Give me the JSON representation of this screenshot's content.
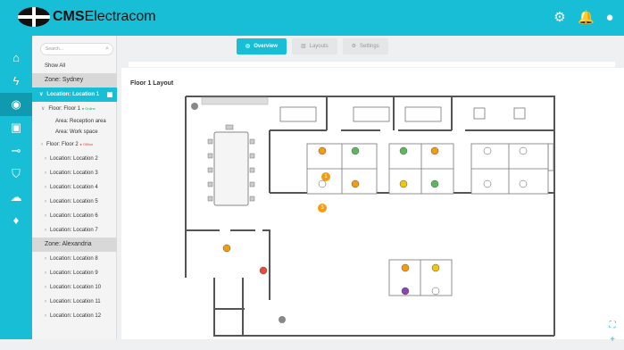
{
  "app": {
    "brand_bold": "CMS",
    "brand_light": "Electracom",
    "icons": [
      "settings-gear-icon",
      "alarm-bell-icon",
      "user-account-icon"
    ]
  },
  "rail": [
    "home-icon",
    "bolt-icon",
    "people-icon",
    "panel-icon",
    "key-icon",
    "shield-icon",
    "cloud-icon",
    "water-icon"
  ],
  "left_panel": {
    "search_placeholder": "Search...",
    "show_all": "Show All",
    "zone_sydney": "Zone: Sydney",
    "location_1": "Location: Location 1",
    "floor_1": "Floor: Floor 1",
    "floor_1_status": "Online",
    "area_reception": "Area: Reception area",
    "area_work": "Area: Work space",
    "floor_2": "Floor: Floor 2",
    "floor_2_status": "Offline",
    "locations_a": [
      "Location: Location 2",
      "Location: Location 3",
      "Location: Location 4",
      "Location: Location 5",
      "Location: Location 6",
      "Location: Location 7"
    ],
    "zone_alexandria": "Zone: Alexandria",
    "locations_b": [
      "Location: Location 8",
      "Location: Location 9",
      "Location: Location 10",
      "Location: Location 11",
      "Location: Location 12"
    ]
  },
  "tabs": [
    {
      "label": "Overview",
      "active": true
    },
    {
      "label": "Layouts",
      "active": false
    },
    {
      "label": "Settings",
      "active": false
    }
  ],
  "floor": {
    "title": "Floor 1 Layout",
    "markers": [
      "1",
      "3"
    ]
  },
  "colors": {
    "accent": "#17bed6",
    "accent_dark": "#0f9ab0",
    "orange": "#f39c12",
    "green": "#5cb85c",
    "yellow": "#f1c40f",
    "purple": "#8e44ad",
    "red": "#e74c3c"
  }
}
